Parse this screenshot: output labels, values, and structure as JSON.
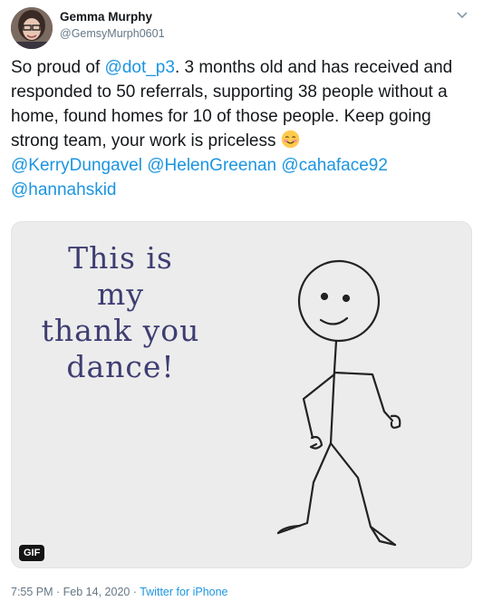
{
  "author": {
    "name": "Gemma Murphy",
    "handle": "@GemsyMurph0601"
  },
  "tweet": {
    "t1": "So proud of ",
    "mention_dot": "@dot_p3",
    "t2": ". 3 months old and has received and responded to 50 referrals, supporting 38 people without a home, found homes for 10 of those people. Keep going strong team, your work is priceless ",
    "mentions": [
      "@KerryDungavel",
      "@HelenGreenan",
      "@cahaface92",
      "@hannahskid"
    ],
    "emoji_icon": "smiling-face-with-blush-icon"
  },
  "media": {
    "caption_lines": [
      "This is",
      "my",
      "thank you",
      "dance!"
    ],
    "badge": "GIF"
  },
  "footer": {
    "time": "7:55 PM",
    "sep1": " · ",
    "date": "Feb 14, 2020",
    "sep2": " · ",
    "source": "Twitter for iPhone"
  },
  "colors": {
    "link": "#1b95e0",
    "secondary_text": "#657786",
    "caption": "#3e3d72"
  }
}
